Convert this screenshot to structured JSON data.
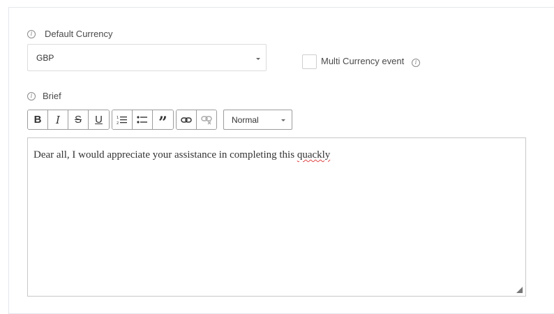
{
  "default_currency": {
    "label": "Default Currency",
    "selected": "GBP"
  },
  "multi_currency": {
    "label": "Multi Currency event",
    "checked": false
  },
  "brief": {
    "label": "Brief",
    "toolbar": {
      "bold": "B",
      "italic": "I",
      "strike": "S",
      "underline": "U",
      "ordered_list": "ordered-list-icon",
      "bullet_list": "bullet-list-icon",
      "quote": "”",
      "link": "link-icon",
      "unlink": "unlink-icon",
      "format_selected": "Normal"
    },
    "content": {
      "before": "Dear all, I would appreciate your assistance in completing this ",
      "misspelled": "quackly"
    }
  },
  "info_glyph": "i"
}
